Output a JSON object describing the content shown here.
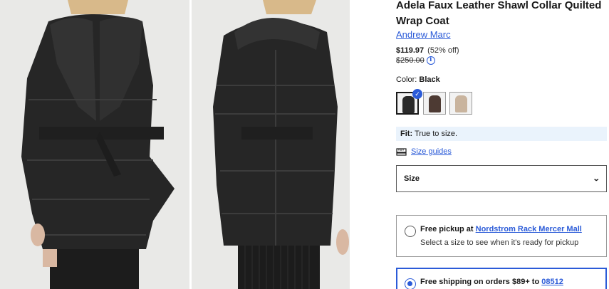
{
  "product": {
    "title": "Adela Faux Leather Shawl Collar Quilted Wrap Coat",
    "brand": "Andrew Marc",
    "price_current": "$119.97",
    "price_discount": "(52% off)",
    "price_original": "$250.00",
    "info_icon_glyph": "i"
  },
  "color": {
    "label": "Color:",
    "value": "Black",
    "swatches": [
      {
        "name": "Black",
        "color": "#2a2a2a",
        "selected": true
      },
      {
        "name": "Brown",
        "color": "#4d3a33",
        "selected": false
      },
      {
        "name": "Tan",
        "color": "#c9b49e",
        "selected": false
      }
    ],
    "check_glyph": "✓"
  },
  "fit": {
    "label": "Fit:",
    "value": "True to size."
  },
  "size_guide": {
    "label": "Size guides",
    "icon": "ruler-icon"
  },
  "size_select": {
    "label": "Size",
    "chevron": "⌄"
  },
  "pickup": {
    "prefix": "Free pickup at",
    "store": "Nordstrom Rack Mercer Mall",
    "note": "Select a size to see when it's ready for pickup"
  },
  "shipping": {
    "prefix": "Free shipping on orders $89+ to",
    "zip": "08512"
  },
  "images": {
    "background": "#e9e9e7",
    "coat_color": "#2a2a2a"
  }
}
